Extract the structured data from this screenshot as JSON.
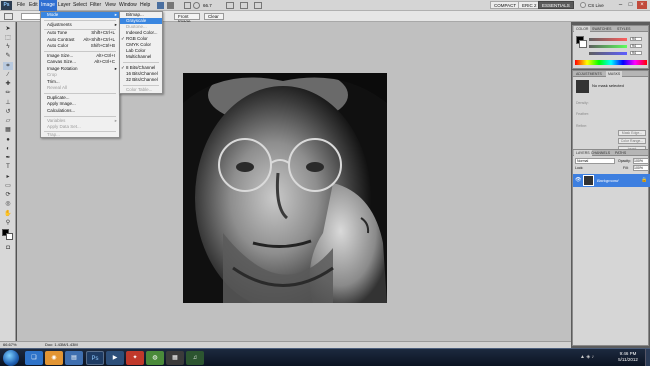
{
  "app": {
    "logo": "Ps"
  },
  "menubar": {
    "items": [
      "File",
      "Edit",
      "Image",
      "Layer",
      "Select",
      "Filter",
      "View",
      "Window",
      "Help"
    ],
    "zoom": "66.7"
  },
  "workspace": {
    "buttons": [
      "COMPACT",
      "ERIC 2",
      "ESSENTIALS"
    ],
    "active": "ESSENTIALS",
    "cs_live": "CS Live"
  },
  "options_bar": {
    "resolution_unit": "pixels/inch",
    "front_image": "Front Image",
    "clear": "Clear"
  },
  "image_menu": {
    "items": [
      {
        "label": "Mode",
        "submenu": true,
        "highlighted": true
      },
      {
        "sep": true
      },
      {
        "label": "Adjustments",
        "submenu": true
      },
      {
        "sep": true
      },
      {
        "label": "Auto Tone",
        "shortcut": "Shift+Ctrl+L"
      },
      {
        "label": "Auto Contrast",
        "shortcut": "Alt+Shift+Ctrl+L"
      },
      {
        "label": "Auto Color",
        "shortcut": "Shift+Ctrl+B"
      },
      {
        "sep": true
      },
      {
        "label": "Image Size...",
        "shortcut": "Alt+Ctrl+I"
      },
      {
        "label": "Canvas Size...",
        "shortcut": "Alt+Ctrl+C"
      },
      {
        "label": "Image Rotation",
        "submenu": true
      },
      {
        "label": "Crop",
        "disabled": true
      },
      {
        "label": "Trim..."
      },
      {
        "label": "Reveal All",
        "disabled": true
      },
      {
        "sep": true
      },
      {
        "label": "Duplicate..."
      },
      {
        "label": "Apply Image..."
      },
      {
        "label": "Calculations..."
      },
      {
        "sep": true
      },
      {
        "label": "Variables",
        "submenu": true,
        "disabled": true
      },
      {
        "label": "Apply Data Set...",
        "disabled": true
      },
      {
        "sep": true
      },
      {
        "label": "Trap...",
        "disabled": true
      }
    ]
  },
  "mode_menu": {
    "items": [
      {
        "label": "Bitmap..."
      },
      {
        "label": "Grayscale",
        "highlighted": true
      },
      {
        "label": "Duotone...",
        "disabled": true
      },
      {
        "label": "Indexed Color..."
      },
      {
        "label": "RGB Color",
        "checked": true
      },
      {
        "label": "CMYK Color"
      },
      {
        "label": "Lab Color"
      },
      {
        "label": "Multichannel"
      },
      {
        "sep": true
      },
      {
        "label": "8 Bits/Channel",
        "checked": true
      },
      {
        "label": "16 Bits/Channel"
      },
      {
        "label": "32 Bits/Channel"
      },
      {
        "sep": true
      },
      {
        "label": "Color Table...",
        "disabled": true
      }
    ]
  },
  "color_panel": {
    "tabs": [
      "COLOR",
      "SWATCHES",
      "STYLES"
    ],
    "r": "94",
    "g": "94",
    "b": "94"
  },
  "adjustments_panel": {
    "tabs": [
      "ADJUSTMENTS",
      "MASKS"
    ],
    "message": "No mask selected",
    "labels": [
      "Density:",
      "Feather:",
      "Refine:"
    ],
    "buttons": [
      "Mask Edge...",
      "Color Range...",
      "Invert"
    ]
  },
  "layers_panel": {
    "tabs": [
      "LAYERS",
      "CHANNELS",
      "PATHS"
    ],
    "blend_mode": "Normal",
    "opacity_label": "Opacity:",
    "opacity": "100%",
    "lock_label": "Lock:",
    "fill_label": "Fill:",
    "fill": "100%",
    "layers": [
      {
        "name": "Background"
      }
    ]
  },
  "status_bar": {
    "zoom": "66.67%",
    "doc": "Doc: 1.43M/1.43M"
  },
  "taskbar": {
    "time": "9:46 PM",
    "date": "5/11/2012"
  }
}
